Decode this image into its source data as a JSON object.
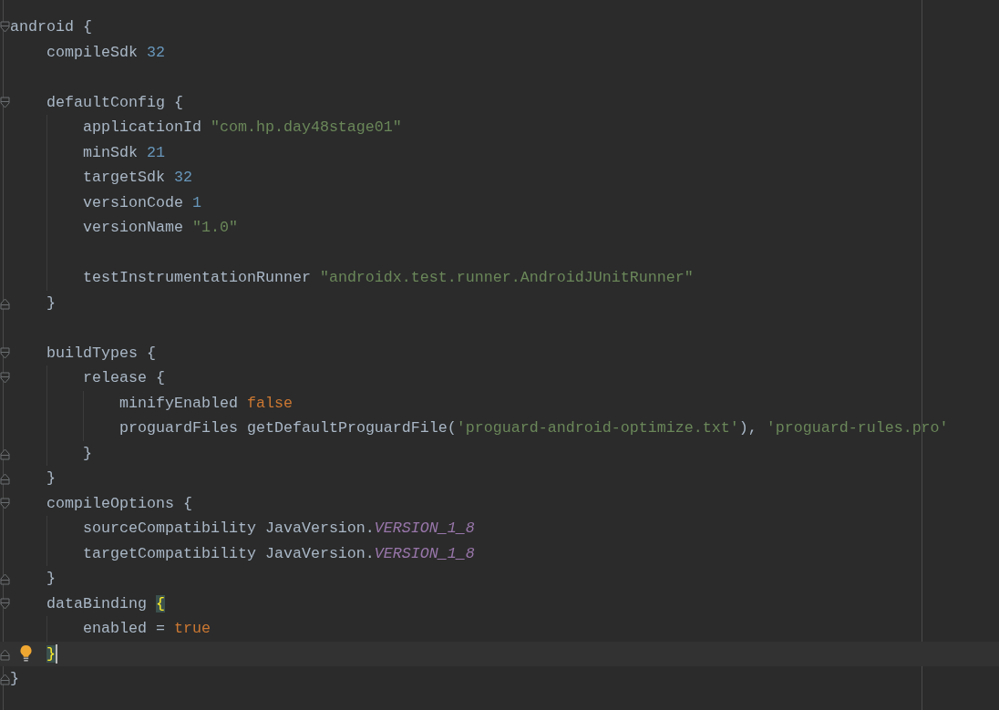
{
  "editor": {
    "code": [
      {
        "kind": "block",
        "current": false,
        "tokens": [
          {
            "text": "android "
          },
          {
            "text": "{",
            "matched": false
          }
        ],
        "children": [
          {
            "kind": "line",
            "current": false,
            "tokens": [
              {
                "text": "compileSdk "
              },
              {
                "kind": "number",
                "text": "32"
              }
            ]
          },
          {
            "kind": "blank"
          },
          {
            "kind": "block",
            "current": false,
            "tokens": [
              {
                "text": "defaultConfig "
              },
              {
                "text": "{",
                "matched": false
              }
            ],
            "children": [
              {
                "kind": "line",
                "current": false,
                "tokens": [
                  {
                    "text": "applicationId "
                  },
                  {
                    "kind": "string",
                    "text": "\"com.hp.day48stage01\""
                  }
                ]
              },
              {
                "kind": "line",
                "current": false,
                "tokens": [
                  {
                    "text": "minSdk "
                  },
                  {
                    "kind": "number",
                    "text": "21"
                  }
                ]
              },
              {
                "kind": "line",
                "current": false,
                "tokens": [
                  {
                    "text": "targetSdk "
                  },
                  {
                    "kind": "number",
                    "text": "32"
                  }
                ]
              },
              {
                "kind": "line",
                "current": false,
                "tokens": [
                  {
                    "text": "versionCode "
                  },
                  {
                    "kind": "number",
                    "text": "1"
                  }
                ]
              },
              {
                "kind": "line",
                "current": false,
                "tokens": [
                  {
                    "text": "versionName "
                  },
                  {
                    "kind": "string",
                    "text": "\"1.0\""
                  }
                ]
              },
              {
                "kind": "blank"
              },
              {
                "kind": "line",
                "current": false,
                "tokens": [
                  {
                    "text": "testInstrumentationRunner "
                  },
                  {
                    "kind": "string",
                    "text": "\"androidx.test.runner.AndroidJUnitRunner\""
                  }
                ]
              }
            ],
            "end": {
              "current": false,
              "tokens": [
                {
                  "text": "}",
                  "matched": false
                }
              ]
            }
          },
          {
            "kind": "blank"
          },
          {
            "kind": "block",
            "current": false,
            "tokens": [
              {
                "text": "buildTypes "
              },
              {
                "text": "{",
                "matched": false
              }
            ],
            "children": [
              {
                "kind": "block",
                "current": false,
                "tokens": [
                  {
                    "text": "release "
                  },
                  {
                    "text": "{",
                    "matched": false
                  }
                ],
                "children": [
                  {
                    "kind": "line",
                    "current": false,
                    "tokens": [
                      {
                        "text": "minifyEnabled "
                      },
                      {
                        "kind": "keyword",
                        "text": "false"
                      }
                    ]
                  },
                  {
                    "kind": "line",
                    "current": false,
                    "tokens": [
                      {
                        "text": "proguardFiles getDefaultProguardFile("
                      },
                      {
                        "kind": "string",
                        "text": "'proguard-android-optimize.txt'"
                      },
                      {
                        "text": "), "
                      },
                      {
                        "kind": "string",
                        "text": "'proguard-rules.pro'"
                      }
                    ]
                  }
                ],
                "end": {
                  "current": false,
                  "tokens": [
                    {
                      "text": "}",
                      "matched": false
                    }
                  ]
                }
              }
            ],
            "end": {
              "current": false,
              "tokens": [
                {
                  "text": "}",
                  "matched": false
                }
              ]
            }
          },
          {
            "kind": "block",
            "current": false,
            "tokens": [
              {
                "text": "compileOptions "
              },
              {
                "text": "{",
                "matched": false
              }
            ],
            "children": [
              {
                "kind": "line",
                "current": false,
                "tokens": [
                  {
                    "text": "sourceCompatibility JavaVersion."
                  },
                  {
                    "kind": "constant",
                    "text": "VERSION_1_8"
                  }
                ]
              },
              {
                "kind": "line",
                "current": false,
                "tokens": [
                  {
                    "text": "targetCompatibility JavaVersion."
                  },
                  {
                    "kind": "constant",
                    "text": "VERSION_1_8"
                  }
                ]
              }
            ],
            "end": {
              "current": false,
              "tokens": [
                {
                  "text": "}",
                  "matched": false
                }
              ]
            }
          },
          {
            "kind": "block",
            "current": false,
            "tokens": [
              {
                "text": "dataBinding "
              },
              {
                "text": "{",
                "matched": true
              }
            ],
            "children": [
              {
                "kind": "line",
                "current": false,
                "tokens": [
                  {
                    "text": "enabled = "
                  },
                  {
                    "kind": "keyword",
                    "text": "true"
                  }
                ]
              }
            ],
            "end": {
              "current": true,
              "tokens": [
                {
                  "text": "}",
                  "matched": true
                }
              ]
            }
          }
        ],
        "end": {
          "current": false,
          "tokens": [
            {
              "text": "}",
              "matched": false
            }
          ]
        }
      }
    ]
  }
}
